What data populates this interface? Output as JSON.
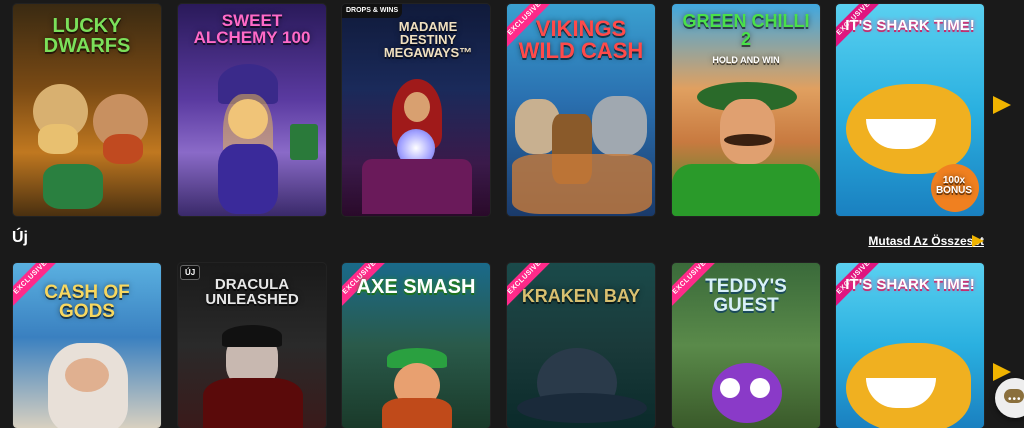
{
  "row1": {
    "games": [
      {
        "title": "LUCKY DWARFS",
        "badge": ""
      },
      {
        "title": "SWEET ALCHEMY 100",
        "badge": ""
      },
      {
        "title": "MADAME DESTINY MEGAWAYS™",
        "badge": "DROPS & WINS"
      },
      {
        "title": "VIKINGS WILD CASH",
        "badge": "EXCLUSIVE"
      },
      {
        "title": "GREEN CHILLI 2",
        "subtitle": "HOLD AND WIN",
        "badge": ""
      },
      {
        "title": "IT'S SHARK TIME!",
        "extra": "100x BONUS",
        "badge": "EXCLUSIVE"
      }
    ]
  },
  "section": {
    "title": "Új",
    "show_all_label": "Mutasd Az Összeset"
  },
  "row2": {
    "games": [
      {
        "title": "CASH OF GODS",
        "badge": "EXCLUSIVE"
      },
      {
        "title": "DRACULA UNLEASHED",
        "badge": "ÚJ"
      },
      {
        "title": "AXE SMASH",
        "badge": "EXCLUSIVE"
      },
      {
        "title": "KRAKEN BAY",
        "badge": "EXCLUSIVE"
      },
      {
        "title": "TEDDY'S GUEST",
        "badge": "EXCLUSIVE"
      },
      {
        "title": "IT'S SHARK TIME!",
        "badge": "EXCLUSIVE"
      }
    ]
  },
  "icons": {
    "next_arrow": "chevron-right-icon",
    "chat": "chat-icon"
  },
  "colors": {
    "accent": "#f0b400",
    "background": "#1a1a1a",
    "exclusive_ribbon": "#ff2a8a"
  }
}
